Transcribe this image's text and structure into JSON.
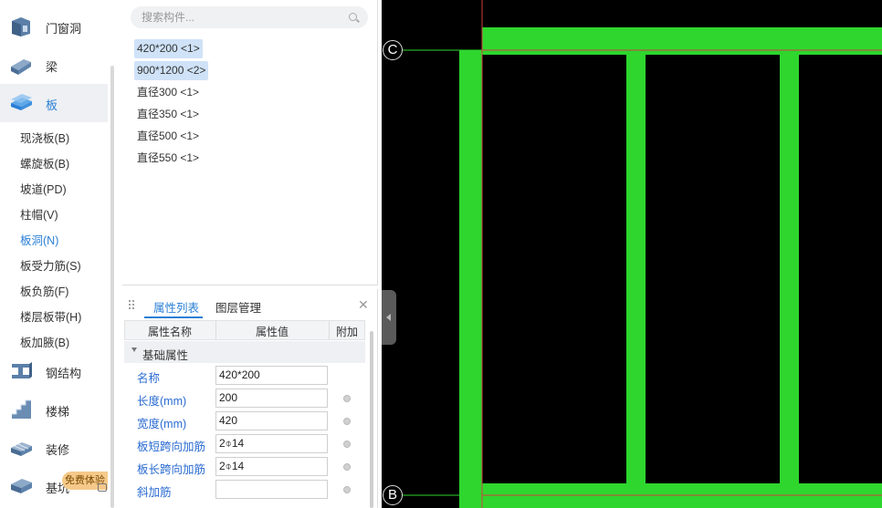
{
  "nav": {
    "categories": [
      {
        "label": "门窗洞",
        "icon": "door-window-icon"
      },
      {
        "label": "梁",
        "icon": "beam-icon"
      },
      {
        "label": "板",
        "icon": "slab-icon"
      },
      {
        "label": "钢结构",
        "icon": "steel-structure-icon"
      },
      {
        "label": "楼梯",
        "icon": "stairs-icon"
      },
      {
        "label": "装修",
        "icon": "decoration-icon"
      },
      {
        "label": "基坑",
        "icon": "foundation-pit-icon"
      }
    ],
    "active_category": "板",
    "sub_items": [
      {
        "label": "现浇板(B)"
      },
      {
        "label": "螺旋板(B)"
      },
      {
        "label": "坡道(PD)"
      },
      {
        "label": "柱帽(V)"
      },
      {
        "label": "板洞(N)"
      },
      {
        "label": "板受力筋(S)"
      },
      {
        "label": "板负筋(F)"
      },
      {
        "label": "楼层板带(H)"
      },
      {
        "label": "板加腋(B)"
      }
    ],
    "active_sub_item": "板洞(N)",
    "promo_badge": "免费体验"
  },
  "component_list": {
    "search_placeholder": "搜索构件...",
    "items": [
      {
        "label": "420*200 <1>",
        "selected": true
      },
      {
        "label": "900*1200 <2>",
        "selected": true
      },
      {
        "label": "直径300 <1>",
        "selected": false
      },
      {
        "label": "直径350 <1>",
        "selected": false
      },
      {
        "label": "直径500 <1>",
        "selected": false
      },
      {
        "label": "直径550 <1>",
        "selected": false
      }
    ]
  },
  "properties": {
    "tabs": [
      {
        "label": "属性列表",
        "active": true
      },
      {
        "label": "图层管理",
        "active": false
      }
    ],
    "columns": [
      "属性名称",
      "属性值",
      "附加"
    ],
    "group_label": "基础属性",
    "rows": [
      {
        "name": "名称",
        "value": "420*200",
        "has_extra": false
      },
      {
        "name": "长度(mm)",
        "value": "200",
        "has_extra": true
      },
      {
        "name": "宽度(mm)",
        "value": "420",
        "has_extra": true
      },
      {
        "name": "板短跨向加筋",
        "value": "2⌽14",
        "has_extra": true
      },
      {
        "name": "板长跨向加筋",
        "value": "2⌽14",
        "has_extra": true
      },
      {
        "name": "斜加筋",
        "value": "",
        "has_extra": true
      }
    ]
  },
  "canvas": {
    "background": "#000000",
    "slab_color": "#2ed62e",
    "axis_line_color": "#d04040",
    "axis_labels": [
      "C",
      "B"
    ]
  },
  "colors": {
    "accent": "#2a7fd5",
    "selected_item_bg": "#cfe2f7",
    "nav_active_bg": "#eef0f3"
  }
}
